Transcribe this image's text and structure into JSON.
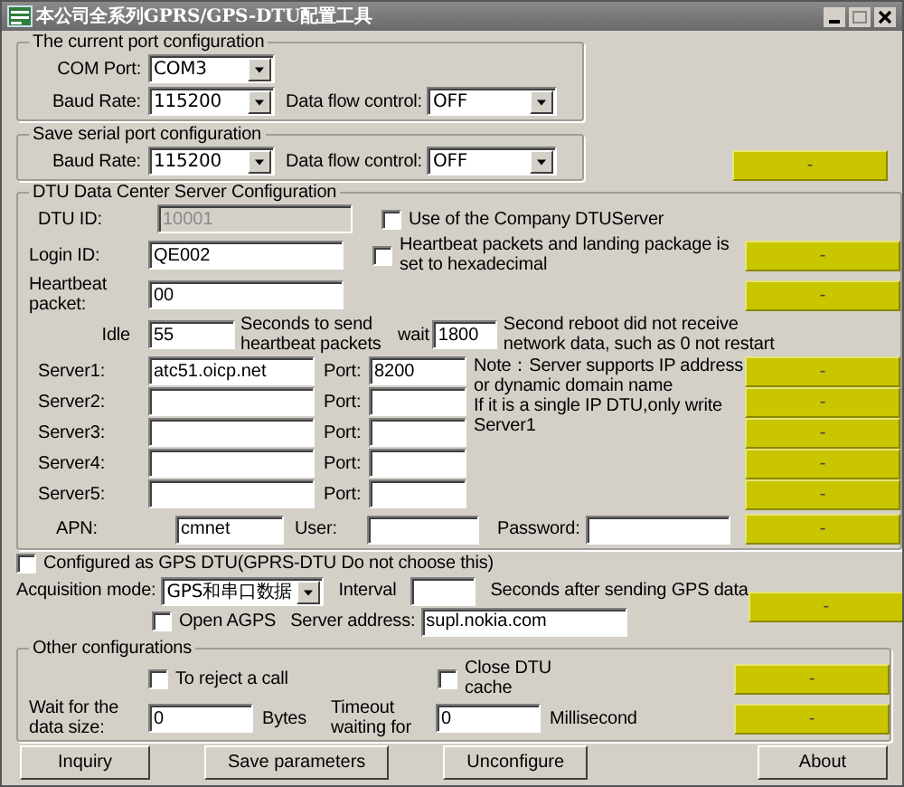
{
  "window": {
    "title": "本公司全系列GPRS/GPS-DTU配置工具"
  },
  "current_port": {
    "title": "The current port configuration",
    "com_port": {
      "label": "COM Port:",
      "value": "COM3"
    },
    "baud_rate": {
      "label": "Baud Rate:",
      "value": "115200"
    },
    "flow_control": {
      "label": "Data flow control:",
      "value": "OFF"
    }
  },
  "save_port": {
    "title": "Save serial port configuration",
    "baud_rate": {
      "label": "Baud Rate:",
      "value": "115200"
    },
    "flow_control": {
      "label": "Data flow control:",
      "value": "OFF"
    },
    "indicator": "-"
  },
  "dtu": {
    "title": "DTU Data Center Server Configuration",
    "dtu_id": {
      "label": "DTU ID:",
      "value": "10001",
      "disabled": true
    },
    "company_server": {
      "label": "Use of the Company DTUServer",
      "checked": false
    },
    "login_id": {
      "label": "Login ID:",
      "value": "QE002"
    },
    "hex": {
      "label": "Heartbeat packets and landing package is set to hexadecimal",
      "checked": false,
      "indicator": "-"
    },
    "heartbeat": {
      "label": "Heartbeat packet:",
      "value": "00",
      "indicator": "-"
    },
    "idle": {
      "label": "Idle",
      "value": "55",
      "unit": "Seconds to send heartbeat packets"
    },
    "wait": {
      "label": "wait",
      "value": "1800",
      "unit": "Second reboot did not receive network data, such as 0 not restart"
    },
    "servers": [
      {
        "label": "Server1:",
        "value": "atc51.oicp.net",
        "port_label": "Port:",
        "port": "8200",
        "indicator": "-"
      },
      {
        "label": "Server2:",
        "port_label": "Port:",
        "indicator": "-"
      },
      {
        "label": "Server3:",
        "port_label": "Port:",
        "indicator": "-"
      },
      {
        "label": "Server4:",
        "port_label": "Port:",
        "indicator": "-"
      },
      {
        "label": "Server5:",
        "port_label": "Port:",
        "indicator": "-"
      }
    ],
    "notes": [
      "Note：Server supports IP address or dynamic domain name",
      "If it is a single IP DTU,only write Server1"
    ],
    "apn": {
      "label": "APN:",
      "value": "cmnet"
    },
    "user": {
      "label": "User:"
    },
    "password": {
      "label": "Password:"
    },
    "apn_indicator": "-"
  },
  "gps": {
    "enabled": {
      "label": "Configured as GPS DTU(GPRS-DTU Do not choose this)",
      "checked": false
    },
    "mode": {
      "label": "Acquisition mode:",
      "value": "GPS和串口数据"
    },
    "interval": {
      "label": "Interval",
      "unit": "Seconds after sending GPS data"
    },
    "indicator": "-",
    "agps": {
      "label": "Open AGPS",
      "checked": false
    },
    "server_address": {
      "label": "Server address:",
      "value": "supl.nokia.com"
    }
  },
  "other": {
    "title": "Other configurations",
    "reject_call": {
      "label": "To reject a call",
      "checked": false
    },
    "close_cache": {
      "label": "Close DTU cache",
      "checked": false,
      "indicator": "-"
    },
    "data_size": {
      "label": "Wait for the data size:",
      "value": "0",
      "unit": "Bytes"
    },
    "timeout": {
      "label": "Timeout waiting for",
      "value": "0",
      "unit": "Millisecond",
      "indicator": "-"
    }
  },
  "buttons": [
    {
      "label": "Inquiry"
    },
    {
      "label": "Save parameters"
    },
    {
      "label": "Unconfigure"
    },
    {
      "label": "About"
    }
  ]
}
